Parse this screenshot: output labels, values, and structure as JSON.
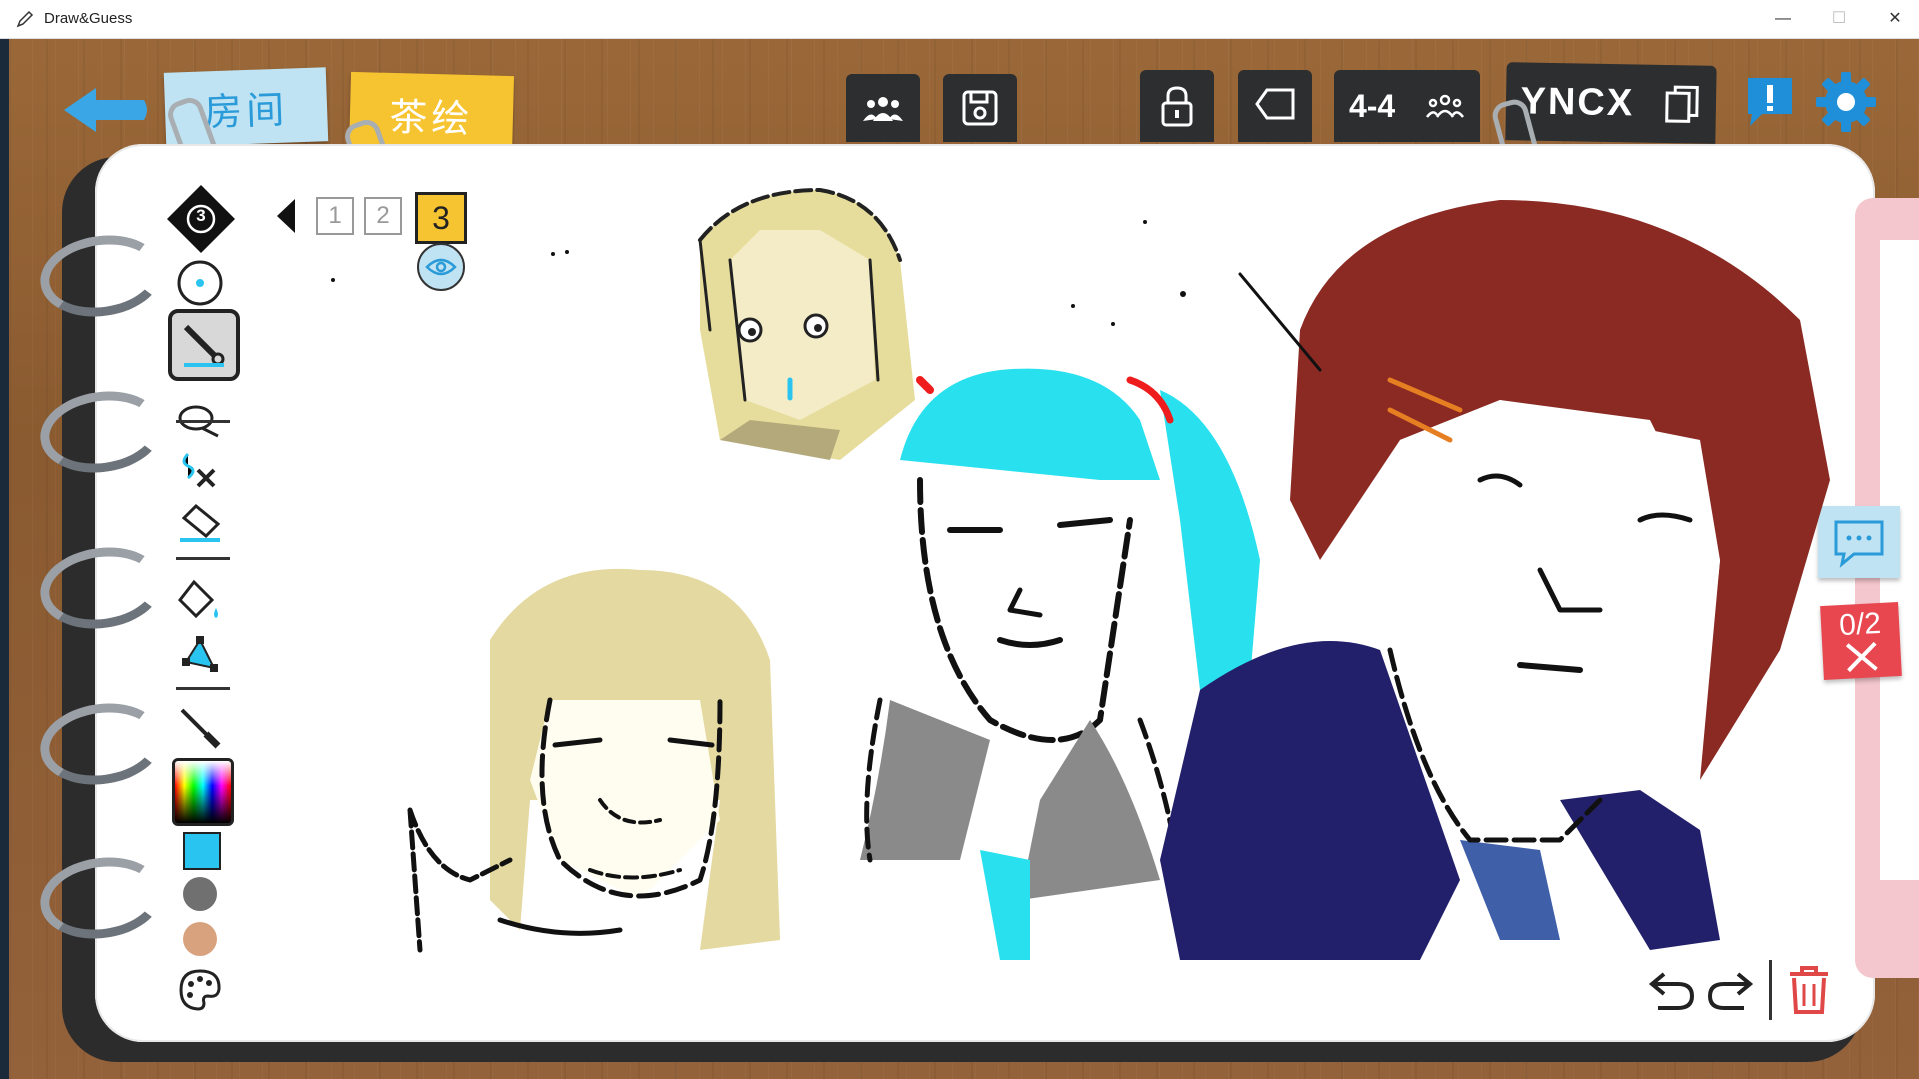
{
  "window": {
    "title": "Draw&Guess",
    "minimize_glyph": "—",
    "maximize_glyph": "☐",
    "close_glyph": "✕"
  },
  "header": {
    "back_icon": "back-arrow-icon",
    "tab_room_label": "房间",
    "tab_tea_label": "茶绘",
    "room_code": "YNCX",
    "player_count": "4-4"
  },
  "toolbar": {
    "layer_badge": "3"
  },
  "pages": {
    "p1": "1",
    "p2": "2",
    "p3": "3"
  },
  "side": {
    "score": "0/2"
  },
  "colors": {
    "accent_blue": "#2a9bd8",
    "selected_swatch": "#29c5f0",
    "gray_swatch": "#707070",
    "skin_swatch": "#d8a27e",
    "yellow_tab": "#f6c430",
    "red_card": "#e8474f",
    "trash_red": "#e04747"
  }
}
